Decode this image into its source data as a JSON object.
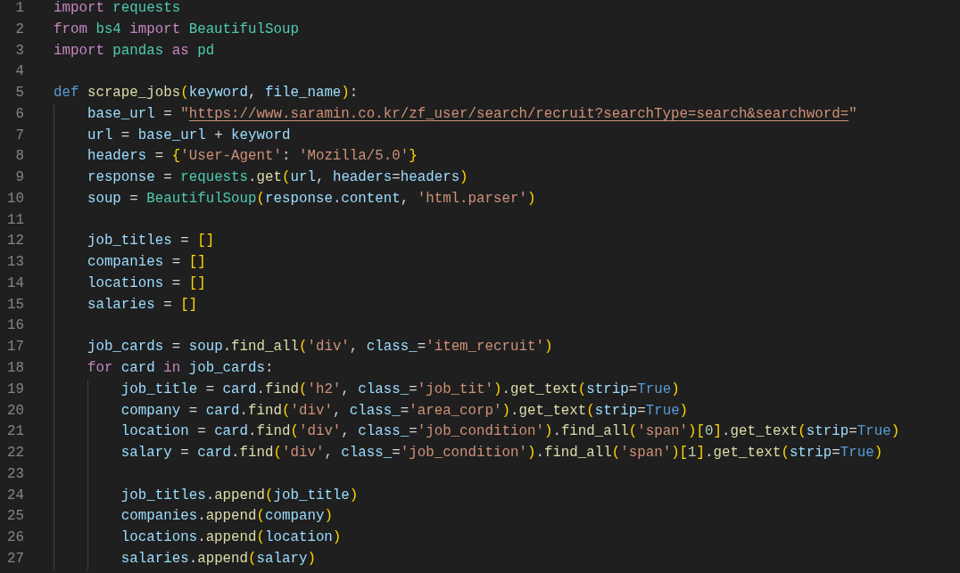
{
  "editor": {
    "lines": [
      {
        "number": "1",
        "tokens": [
          {
            "kind": "keyword",
            "text": "import"
          },
          {
            "kind": "type",
            "text": " requests"
          }
        ]
      },
      {
        "number": "2",
        "tokens": [
          {
            "kind": "keyword",
            "text": "from"
          },
          {
            "kind": "type",
            "text": " bs4"
          },
          {
            "kind": "keyword",
            "text": " import"
          },
          {
            "kind": "type",
            "text": " BeautifulSoup"
          }
        ]
      },
      {
        "number": "3",
        "tokens": [
          {
            "kind": "keyword",
            "text": "import"
          },
          {
            "kind": "type",
            "text": " pandas"
          },
          {
            "kind": "keyword",
            "text": " as"
          },
          {
            "kind": "type",
            "text": " pd"
          }
        ]
      },
      {
        "number": "4"
      },
      {
        "number": "5",
        "tokens": [
          {
            "kind": "storage",
            "text": "def"
          },
          {
            "kind": "function",
            "text": " scrape_jobs"
          },
          {
            "kind": "bracket",
            "text": "("
          },
          {
            "kind": "variable",
            "text": "keyword"
          },
          {
            "kind": "plain",
            "text": ", "
          },
          {
            "kind": "variable",
            "text": "file_name"
          },
          {
            "kind": "bracket",
            "text": ")"
          },
          {
            "kind": "plain",
            "text": ":"
          }
        ]
      },
      {
        "number": "6",
        "tokens": [
          {
            "kind": "variable",
            "text": "    base_url"
          },
          {
            "kind": "plain",
            "text": " = "
          },
          {
            "kind": "string",
            "text": "\""
          },
          {
            "kind": "link",
            "text": "https://www.saramin.co.kr/zf_user/search/recruit?searchType=search&searchword="
          },
          {
            "kind": "string",
            "text": "\""
          }
        ]
      },
      {
        "number": "7",
        "tokens": [
          {
            "kind": "variable",
            "text": "    url"
          },
          {
            "kind": "plain",
            "text": " = "
          },
          {
            "kind": "variable",
            "text": "base_url"
          },
          {
            "kind": "plain",
            "text": " + "
          },
          {
            "kind": "variable",
            "text": "keyword"
          }
        ]
      },
      {
        "number": "8",
        "tokens": [
          {
            "kind": "variable",
            "text": "    headers"
          },
          {
            "kind": "plain",
            "text": " = "
          },
          {
            "kind": "bracket",
            "text": "{"
          },
          {
            "kind": "string",
            "text": "'User-Agent'"
          },
          {
            "kind": "plain",
            "text": ": "
          },
          {
            "kind": "string",
            "text": "'Mozilla/5.0'"
          },
          {
            "kind": "bracket",
            "text": "}"
          }
        ]
      },
      {
        "number": "9",
        "tokens": [
          {
            "kind": "variable",
            "text": "    response"
          },
          {
            "kind": "plain",
            "text": " = "
          },
          {
            "kind": "type",
            "text": "requests"
          },
          {
            "kind": "plain",
            "text": "."
          },
          {
            "kind": "function",
            "text": "get"
          },
          {
            "kind": "bracket",
            "text": "("
          },
          {
            "kind": "variable",
            "text": "url"
          },
          {
            "kind": "plain",
            "text": ", "
          },
          {
            "kind": "variable",
            "text": "headers"
          },
          {
            "kind": "plain",
            "text": "="
          },
          {
            "kind": "variable",
            "text": "headers"
          },
          {
            "kind": "bracket",
            "text": ")"
          }
        ]
      },
      {
        "number": "10",
        "tokens": [
          {
            "kind": "variable",
            "text": "    soup"
          },
          {
            "kind": "plain",
            "text": " = "
          },
          {
            "kind": "type",
            "text": "BeautifulSoup"
          },
          {
            "kind": "bracket",
            "text": "("
          },
          {
            "kind": "variable",
            "text": "response"
          },
          {
            "kind": "plain",
            "text": "."
          },
          {
            "kind": "variable",
            "text": "content"
          },
          {
            "kind": "plain",
            "text": ", "
          },
          {
            "kind": "string",
            "text": "'html.parser'"
          },
          {
            "kind": "bracket",
            "text": ")"
          }
        ]
      },
      {
        "number": "11"
      },
      {
        "number": "12",
        "tokens": [
          {
            "kind": "variable",
            "text": "    job_titles"
          },
          {
            "kind": "plain",
            "text": " = "
          },
          {
            "kind": "bracket",
            "text": "[]"
          }
        ]
      },
      {
        "number": "13",
        "tokens": [
          {
            "kind": "variable",
            "text": "    companies"
          },
          {
            "kind": "plain",
            "text": " = "
          },
          {
            "kind": "bracket",
            "text": "[]"
          }
        ]
      },
      {
        "number": "14",
        "tokens": [
          {
            "kind": "variable",
            "text": "    locations"
          },
          {
            "kind": "plain",
            "text": " = "
          },
          {
            "kind": "bracket",
            "text": "[]"
          }
        ]
      },
      {
        "number": "15",
        "tokens": [
          {
            "kind": "variable",
            "text": "    salaries"
          },
          {
            "kind": "plain",
            "text": " = "
          },
          {
            "kind": "bracket",
            "text": "[]"
          }
        ]
      },
      {
        "number": "16"
      },
      {
        "number": "17",
        "tokens": [
          {
            "kind": "variable",
            "text": "    job_cards"
          },
          {
            "kind": "plain",
            "text": " = "
          },
          {
            "kind": "variable",
            "text": "soup"
          },
          {
            "kind": "plain",
            "text": "."
          },
          {
            "kind": "function",
            "text": "find_all"
          },
          {
            "kind": "bracket",
            "text": "("
          },
          {
            "kind": "string",
            "text": "'div'"
          },
          {
            "kind": "plain",
            "text": ", "
          },
          {
            "kind": "variable",
            "text": "class_"
          },
          {
            "kind": "plain",
            "text": "="
          },
          {
            "kind": "string",
            "text": "'item_recruit'"
          },
          {
            "kind": "bracket",
            "text": ")"
          }
        ]
      },
      {
        "number": "18",
        "tokens": [
          {
            "kind": "keyword",
            "text": "    for"
          },
          {
            "kind": "variable",
            "text": " card"
          },
          {
            "kind": "keyword",
            "text": " in"
          },
          {
            "kind": "variable",
            "text": " job_cards"
          },
          {
            "kind": "plain",
            "text": ":"
          }
        ]
      },
      {
        "number": "19",
        "tokens": [
          {
            "kind": "variable",
            "text": "        job_title"
          },
          {
            "kind": "plain",
            "text": " = "
          },
          {
            "kind": "variable",
            "text": "card"
          },
          {
            "kind": "plain",
            "text": "."
          },
          {
            "kind": "function",
            "text": "find"
          },
          {
            "kind": "bracket",
            "text": "("
          },
          {
            "kind": "string",
            "text": "'h2'"
          },
          {
            "kind": "plain",
            "text": ", "
          },
          {
            "kind": "variable",
            "text": "class_"
          },
          {
            "kind": "plain",
            "text": "="
          },
          {
            "kind": "string",
            "text": "'job_tit'"
          },
          {
            "kind": "bracket",
            "text": ")"
          },
          {
            "kind": "plain",
            "text": "."
          },
          {
            "kind": "function",
            "text": "get_text"
          },
          {
            "kind": "bracket",
            "text": "("
          },
          {
            "kind": "variable",
            "text": "strip"
          },
          {
            "kind": "plain",
            "text": "="
          },
          {
            "kind": "storage",
            "text": "True"
          },
          {
            "kind": "bracket",
            "text": ")"
          }
        ]
      },
      {
        "number": "20",
        "tokens": [
          {
            "kind": "variable",
            "text": "        company"
          },
          {
            "kind": "plain",
            "text": " = "
          },
          {
            "kind": "variable",
            "text": "card"
          },
          {
            "kind": "plain",
            "text": "."
          },
          {
            "kind": "function",
            "text": "find"
          },
          {
            "kind": "bracket",
            "text": "("
          },
          {
            "kind": "string",
            "text": "'div'"
          },
          {
            "kind": "plain",
            "text": ", "
          },
          {
            "kind": "variable",
            "text": "class_"
          },
          {
            "kind": "plain",
            "text": "="
          },
          {
            "kind": "string",
            "text": "'area_corp'"
          },
          {
            "kind": "bracket",
            "text": ")"
          },
          {
            "kind": "plain",
            "text": "."
          },
          {
            "kind": "function",
            "text": "get_text"
          },
          {
            "kind": "bracket",
            "text": "("
          },
          {
            "kind": "variable",
            "text": "strip"
          },
          {
            "kind": "plain",
            "text": "="
          },
          {
            "kind": "storage",
            "text": "True"
          },
          {
            "kind": "bracket",
            "text": ")"
          }
        ]
      },
      {
        "number": "21",
        "tokens": [
          {
            "kind": "variable",
            "text": "        location"
          },
          {
            "kind": "plain",
            "text": " = "
          },
          {
            "kind": "variable",
            "text": "card"
          },
          {
            "kind": "plain",
            "text": "."
          },
          {
            "kind": "function",
            "text": "find"
          },
          {
            "kind": "bracket",
            "text": "("
          },
          {
            "kind": "string",
            "text": "'div'"
          },
          {
            "kind": "plain",
            "text": ", "
          },
          {
            "kind": "variable",
            "text": "class_"
          },
          {
            "kind": "plain",
            "text": "="
          },
          {
            "kind": "string",
            "text": "'job_condition'"
          },
          {
            "kind": "bracket",
            "text": ")"
          },
          {
            "kind": "plain",
            "text": "."
          },
          {
            "kind": "function",
            "text": "find_all"
          },
          {
            "kind": "bracket",
            "text": "("
          },
          {
            "kind": "string",
            "text": "'span'"
          },
          {
            "kind": "bracket",
            "text": ")"
          },
          {
            "kind": "bracket",
            "text": "["
          },
          {
            "kind": "number",
            "text": "0"
          },
          {
            "kind": "bracket",
            "text": "]"
          },
          {
            "kind": "plain",
            "text": "."
          },
          {
            "kind": "function",
            "text": "get_text"
          },
          {
            "kind": "bracket",
            "text": "("
          },
          {
            "kind": "variable",
            "text": "strip"
          },
          {
            "kind": "plain",
            "text": "="
          },
          {
            "kind": "storage",
            "text": "True"
          },
          {
            "kind": "bracket",
            "text": ")"
          }
        ]
      },
      {
        "number": "22",
        "tokens": [
          {
            "kind": "variable",
            "text": "        salary"
          },
          {
            "kind": "plain",
            "text": " = "
          },
          {
            "kind": "variable",
            "text": "card"
          },
          {
            "kind": "plain",
            "text": "."
          },
          {
            "kind": "function",
            "text": "find"
          },
          {
            "kind": "bracket",
            "text": "("
          },
          {
            "kind": "string",
            "text": "'div'"
          },
          {
            "kind": "plain",
            "text": ", "
          },
          {
            "kind": "variable",
            "text": "class_"
          },
          {
            "kind": "plain",
            "text": "="
          },
          {
            "kind": "string",
            "text": "'job_condition'"
          },
          {
            "kind": "bracket",
            "text": ")"
          },
          {
            "kind": "plain",
            "text": "."
          },
          {
            "kind": "function",
            "text": "find_all"
          },
          {
            "kind": "bracket",
            "text": "("
          },
          {
            "kind": "string",
            "text": "'span'"
          },
          {
            "kind": "bracket",
            "text": ")"
          },
          {
            "kind": "bracket",
            "text": "["
          },
          {
            "kind": "number",
            "text": "1"
          },
          {
            "kind": "bracket",
            "text": "]"
          },
          {
            "kind": "plain",
            "text": "."
          },
          {
            "kind": "function",
            "text": "get_text"
          },
          {
            "kind": "bracket",
            "text": "("
          },
          {
            "kind": "variable",
            "text": "strip"
          },
          {
            "kind": "plain",
            "text": "="
          },
          {
            "kind": "storage",
            "text": "True"
          },
          {
            "kind": "bracket",
            "text": ")"
          }
        ]
      },
      {
        "number": "23"
      },
      {
        "number": "24",
        "tokens": [
          {
            "kind": "variable",
            "text": "        job_titles"
          },
          {
            "kind": "plain",
            "text": "."
          },
          {
            "kind": "function",
            "text": "append"
          },
          {
            "kind": "bracket",
            "text": "("
          },
          {
            "kind": "variable",
            "text": "job_title"
          },
          {
            "kind": "bracket",
            "text": ")"
          }
        ]
      },
      {
        "number": "25",
        "tokens": [
          {
            "kind": "variable",
            "text": "        companies"
          },
          {
            "kind": "plain",
            "text": "."
          },
          {
            "kind": "function",
            "text": "append"
          },
          {
            "kind": "bracket",
            "text": "("
          },
          {
            "kind": "variable",
            "text": "company"
          },
          {
            "kind": "bracket",
            "text": ")"
          }
        ]
      },
      {
        "number": "26",
        "tokens": [
          {
            "kind": "variable",
            "text": "        locations"
          },
          {
            "kind": "plain",
            "text": "."
          },
          {
            "kind": "function",
            "text": "append"
          },
          {
            "kind": "bracket",
            "text": "("
          },
          {
            "kind": "variable",
            "text": "location"
          },
          {
            "kind": "bracket",
            "text": ")"
          }
        ]
      },
      {
        "number": "27",
        "tokens": [
          {
            "kind": "variable",
            "text": "        salaries"
          },
          {
            "kind": "plain",
            "text": "."
          },
          {
            "kind": "function",
            "text": "append"
          },
          {
            "kind": "bracket",
            "text": "("
          },
          {
            "kind": "variable",
            "text": "salary"
          },
          {
            "kind": "bracket",
            "text": ")"
          }
        ]
      }
    ]
  }
}
